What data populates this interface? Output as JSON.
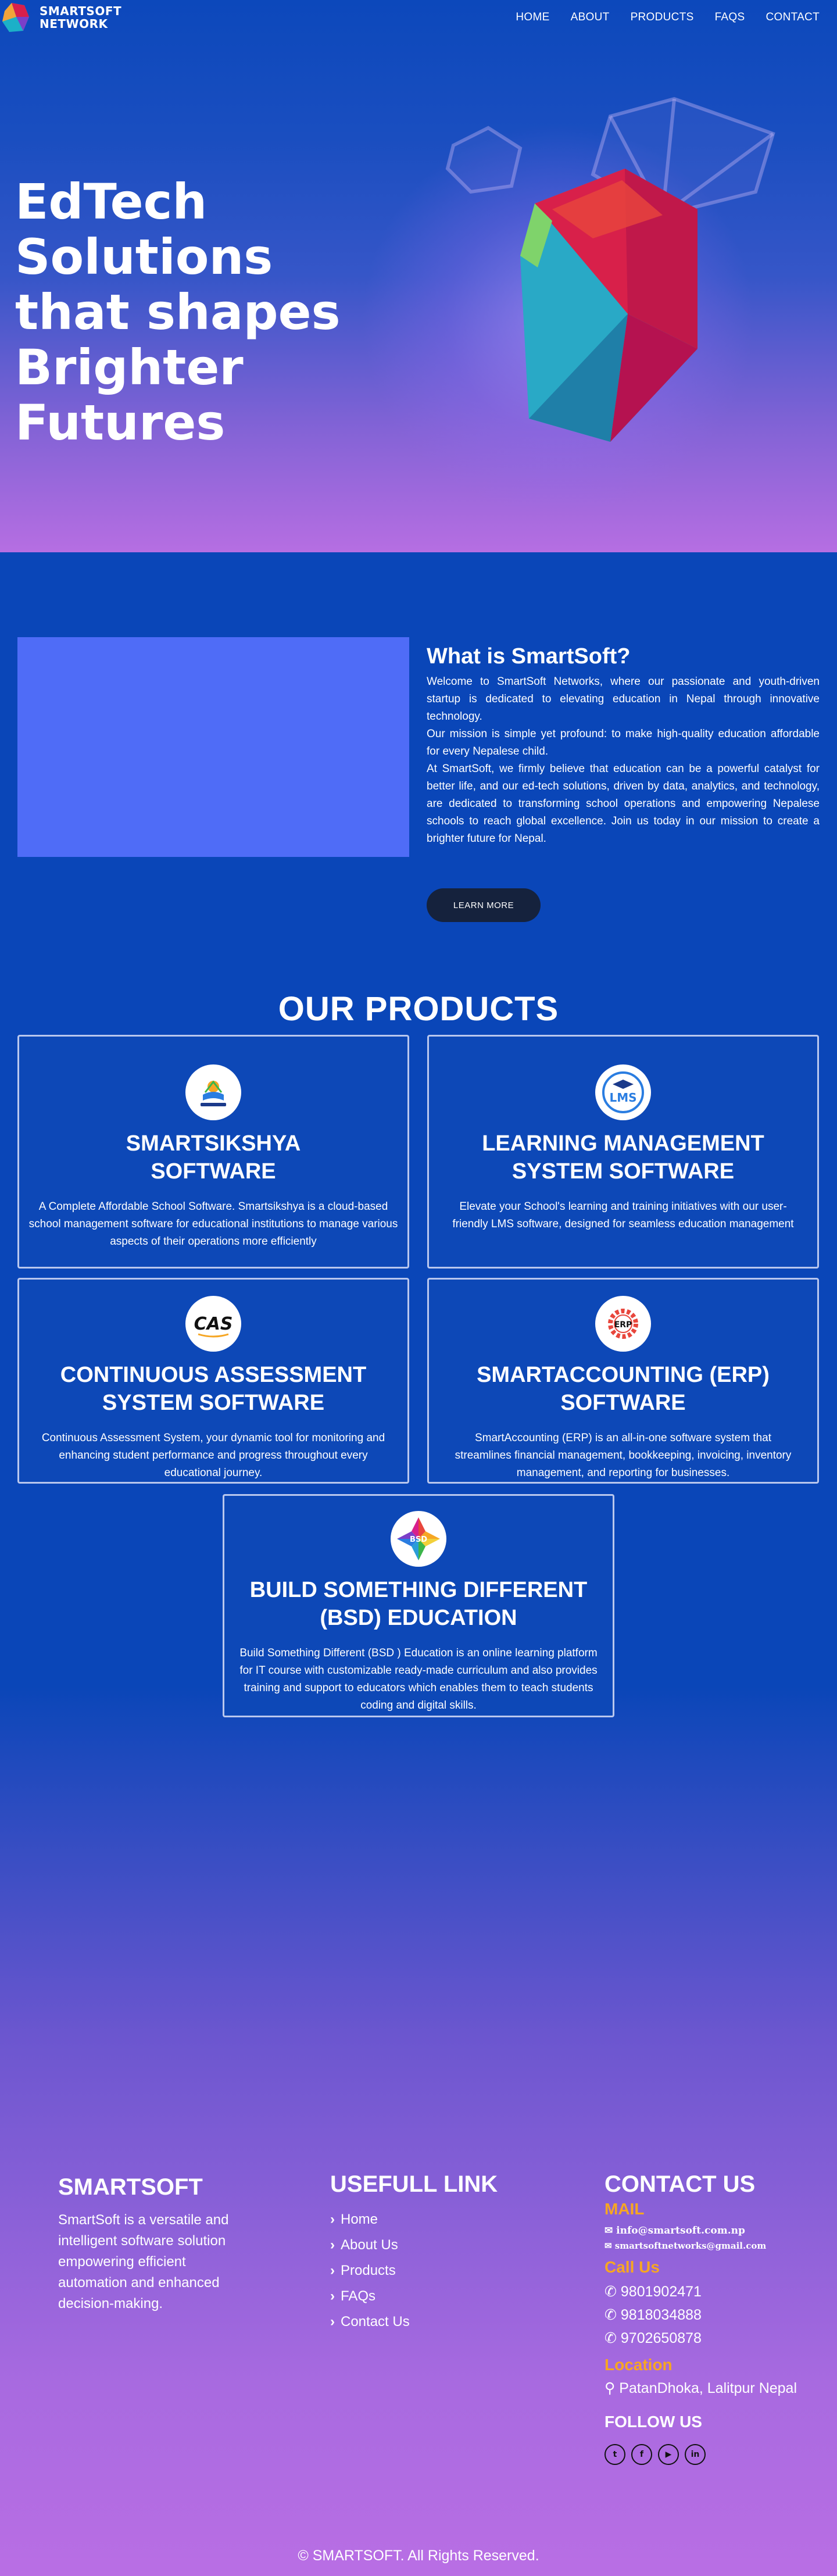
{
  "brand": {
    "line1": "SMARTSOFT",
    "line2": "NETWORK"
  },
  "nav": {
    "home": "HOME",
    "about": "ABOUT",
    "products": "PRODUCTS",
    "faqs": "FAQS",
    "contact": "CONTACT"
  },
  "hero": {
    "title": "EdTech Solutions that shapes Brighter Futures"
  },
  "about": {
    "title": "What is SmartSoft?",
    "p1": "Welcome to SmartSoft Networks, where our passionate and youth-driven startup is dedicated to elevating education in Nepal through innovative technology.",
    "p2": "Our mission is simple yet profound: to make high-quality education affordable for every Nepalese child.",
    "p3": "At SmartSoft, we firmly believe that education can be a powerful catalyst for better life, and our ed-tech solutions, driven by data, analytics, and technology, are dedicated to transforming school operations and empowering Nepalese schools to reach global excellence. Join us today in our mission to create a brighter future for Nepal.",
    "button": "LEARN MORE"
  },
  "products": {
    "title": "OUR PRODUCTS",
    "items": [
      {
        "title": "SMARTSIKSHYA SOFTWARE",
        "desc": "A Complete Affordable School Software. Smartsikshya is a cloud-based school management software for educational institutions to manage various aspects of their operations more efficiently",
        "icon": "smartsikshya-logo-icon"
      },
      {
        "title": "LEARNING MANAGEMENT SYSTEM SOFTWARE",
        "desc": "Elevate your School's learning and training initiatives with our user-friendly LMS software, designed for seamless education management",
        "icon": "lms-logo-icon",
        "badge": "LMS"
      },
      {
        "title": "CONTINUOUS ASSESSMENT SYSTEM SOFTWARE",
        "desc": "Continuous Assessment System, your dynamic tool for monitoring and enhancing student performance and progress throughout every educational journey.",
        "icon": "cas-logo-icon",
        "badge": "CAS"
      },
      {
        "title": "SMARTACCOUNTING (ERP) SOFTWARE",
        "desc": "SmartAccounting (ERP) is an all-in-one software system that streamlines financial management, bookkeeping, invoicing, inventory management, and reporting for businesses.",
        "icon": "erp-logo-icon",
        "badge": "ERP"
      },
      {
        "title": "BUILD SOMETHING DIFFERENT (BSD) EDUCATION",
        "desc": "Build Something Different (BSD ) Education is an online learning platform for IT course with customizable ready-made curriculum and also provides training and support to educators which enables them to teach students coding and digital skills.",
        "icon": "bsd-logo-icon",
        "badge": "BSD"
      }
    ]
  },
  "footer": {
    "about_title": "SMARTSOFT",
    "about_text": "SmartSoft is a versatile and intelligent software solution empowering efficient automation and enhanced decision-making.",
    "links_title": "USEFULL LINK",
    "links": [
      "Home",
      "About Us",
      "Products",
      "FAQs",
      "Contact Us"
    ],
    "contact_title": "CONTACT US",
    "mail_label": "MAIL",
    "mail1": "info@smartsoft.com.np",
    "mail2": "smartsoftnetworks@gmail.com",
    "call_label": "Call Us",
    "phones": [
      "9801902471",
      "9818034888",
      "9702650878"
    ],
    "location_label": "Location",
    "location": "PatanDhoka, Lalitpur Nepal",
    "follow": "FOLLOW US",
    "copyright": "© SMARTSOFT. All Rights Reserved."
  },
  "colors": {
    "primary_blue": "#0a46b8",
    "accent_orange": "#f6a623",
    "about_image": "#4f6cf7",
    "button_dark": "#15223d"
  }
}
